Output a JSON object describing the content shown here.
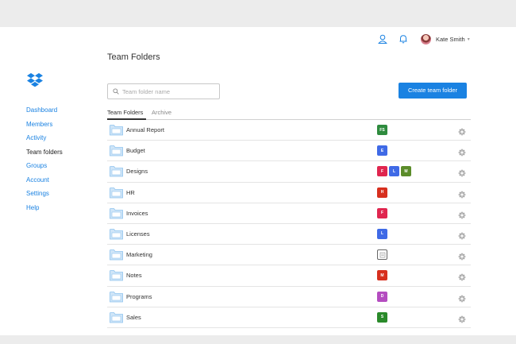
{
  "header": {
    "user_name": "Kate Smith",
    "icons": [
      "user-icon",
      "bell-icon",
      "chevron-down-icon"
    ]
  },
  "sidebar": {
    "items": [
      {
        "label": "Dashboard",
        "active": false
      },
      {
        "label": "Members",
        "active": false
      },
      {
        "label": "Activity",
        "active": false
      },
      {
        "label": "Team folders",
        "active": true
      },
      {
        "label": "Groups",
        "active": false
      },
      {
        "label": "Account",
        "active": false
      },
      {
        "label": "Settings",
        "active": false
      },
      {
        "label": "Help",
        "active": false
      }
    ]
  },
  "main": {
    "title": "Team Folders",
    "search": {
      "placeholder": "Team folder name"
    },
    "create_label": "Create team folder",
    "tabs": [
      {
        "label": "Team Folders",
        "active": true
      },
      {
        "label": "Archive",
        "active": false
      }
    ],
    "folders": [
      {
        "name": "Annual Report",
        "badges": [
          {
            "text": "FS",
            "color": "#2e8b3e"
          }
        ]
      },
      {
        "name": "Budget",
        "badges": [
          {
            "text": "E",
            "color": "#3f6ae6"
          }
        ]
      },
      {
        "name": "Designs",
        "badges": [
          {
            "text": "F",
            "color": "#e0264f"
          },
          {
            "text": "L",
            "color": "#3f6ae6"
          },
          {
            "text": "M",
            "color": "#5b8c2a"
          }
        ]
      },
      {
        "name": "HR",
        "badges": [
          {
            "text": "H",
            "color": "#d72f1e"
          }
        ]
      },
      {
        "name": "Invoices",
        "badges": [
          {
            "text": "F",
            "color": "#e0264f"
          }
        ]
      },
      {
        "name": "Licenses",
        "badges": [
          {
            "text": "L",
            "color": "#3f6ae6"
          }
        ]
      },
      {
        "name": "Marketing",
        "badges": [
          {
            "text": "",
            "color": "outline"
          }
        ]
      },
      {
        "name": "Notes",
        "badges": [
          {
            "text": "M",
            "color": "#d72f1e"
          }
        ]
      },
      {
        "name": "Programs",
        "badges": [
          {
            "text": "D",
            "color": "#b44cc0"
          }
        ]
      },
      {
        "name": "Sales",
        "badges": [
          {
            "text": "S",
            "color": "#2a8a2a"
          }
        ]
      }
    ]
  },
  "colors": {
    "accent": "#1a82e2",
    "folder": "#8fc3ee"
  }
}
